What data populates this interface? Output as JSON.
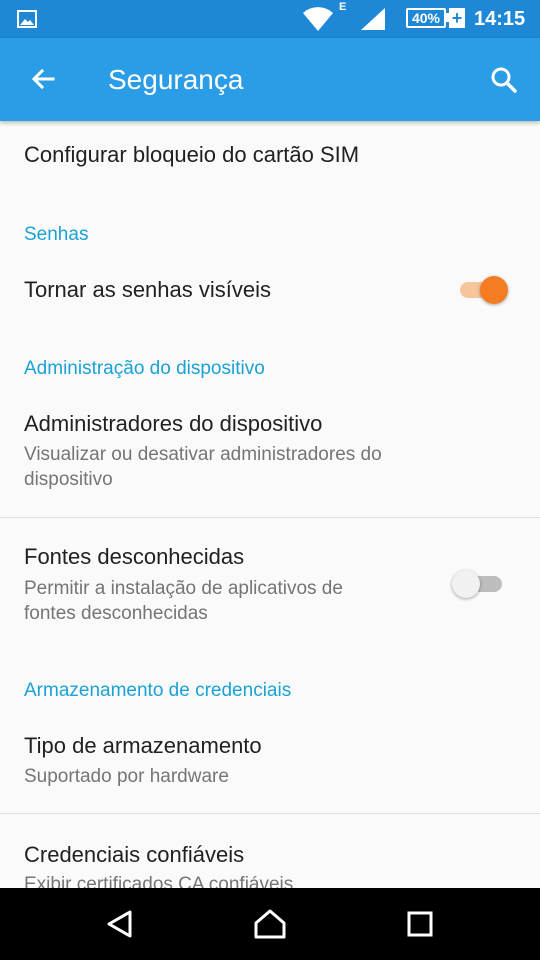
{
  "status_bar": {
    "network_type": "E",
    "battery_percent": "40%",
    "time": "14:15"
  },
  "app_bar": {
    "title": "Segurança",
    "back_icon": "arrow-back-icon",
    "search_icon": "search-icon"
  },
  "rows": {
    "sim_lock": {
      "title": "Configurar bloqueio do cartão SIM"
    },
    "passwords_header": "Senhas",
    "show_passwords": {
      "title": "Tornar as senhas visíveis",
      "enabled": true
    },
    "device_admin_header": "Administração do dispositivo",
    "device_admins": {
      "title": "Administradores do dispositivo",
      "summary_line1": "Visualizar ou desativar administradores do",
      "summary_line2": "dispositivo"
    },
    "unknown_sources": {
      "title": "Fontes desconhecidas",
      "summary_line1": "Permitir a instalação de aplicativos de",
      "summary_line2": "fontes desconhecidas",
      "enabled": false
    },
    "credential_storage_header": "Armazenamento de credenciais",
    "storage_type": {
      "title": "Tipo de armazenamento",
      "summary": "Suportado por hardware"
    },
    "trusted_credentials": {
      "title": "Credenciais confiáveis",
      "summary": "Exibir certificados CA confiáveis"
    }
  },
  "colors": {
    "status_bar": "#1e88d6",
    "app_bar": "#2a9de6",
    "section_header": "#1aa2d6",
    "switch_on_thumb": "#f57c22",
    "switch_on_track": "#f6c59c",
    "switch_off_thumb": "#f1f1f1",
    "switch_off_track": "#bdbdbd"
  },
  "nav_bar": {
    "back_icon": "nav-back-icon",
    "home_icon": "nav-home-icon",
    "recents_icon": "nav-recents-icon"
  }
}
